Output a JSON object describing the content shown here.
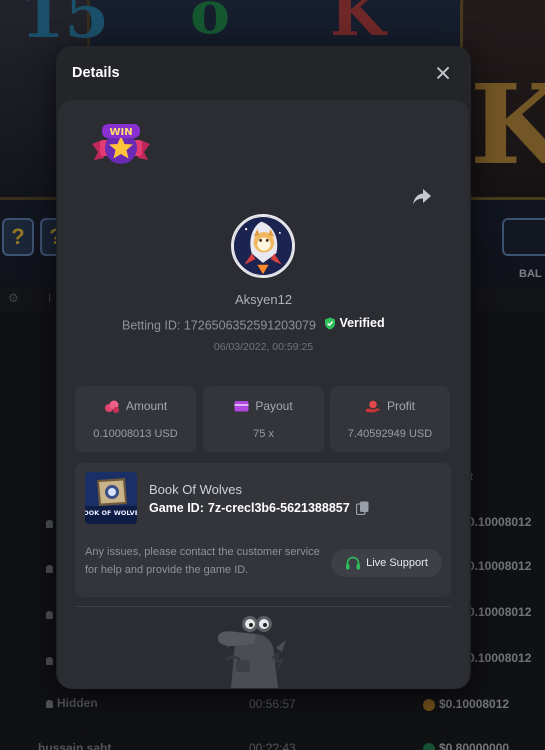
{
  "background": {
    "balance_label": "BAL",
    "rows": [
      {
        "amount": "0.10008012"
      },
      {
        "amount": "0.10008012"
      },
      {
        "amount": "0.10008012"
      },
      {
        "amount": "0.10008012"
      },
      {
        "user": "Hidden",
        "time": "00:56:57",
        "amount": "$0.10008012"
      },
      {
        "user": "hussain sabt",
        "time": "00:??:43",
        "amount": "$0.80000000"
      }
    ],
    "header_fragment": "t"
  },
  "modal": {
    "title": "Details",
    "user": {
      "username": "Aksyen12",
      "betting_id_label": "Betting ID:",
      "betting_id": "1726506352591203079",
      "verified_label": "Verified",
      "datetime": "06/03/2022, 00:59:25"
    },
    "stats": {
      "amount": {
        "label": "Amount",
        "value": "0.10008013 USD"
      },
      "payout": {
        "label": "Payout",
        "value": "75 x"
      },
      "profit": {
        "label": "Profit",
        "value": "7.40592949 USD"
      }
    },
    "game": {
      "name": "Book Of Wolves",
      "id_label": "Game ID:",
      "id": "7z-crecl3b6-5621388857",
      "thumb_text": "BOOK OF WOLVES"
    },
    "support": {
      "text": "Any issues, please contact the customer service for help and provide the game ID.",
      "button_label": "Live Support"
    },
    "badge_text": "WIN"
  },
  "colors": {
    "modal_bg": "#232529",
    "card_bg": "#2b2d32",
    "stat_bg": "#33353b",
    "verified_green": "#2fbf5b",
    "amount_icon": "#e0466e",
    "payout_icon": "#b048e0",
    "profit_icon": "#e04848"
  }
}
